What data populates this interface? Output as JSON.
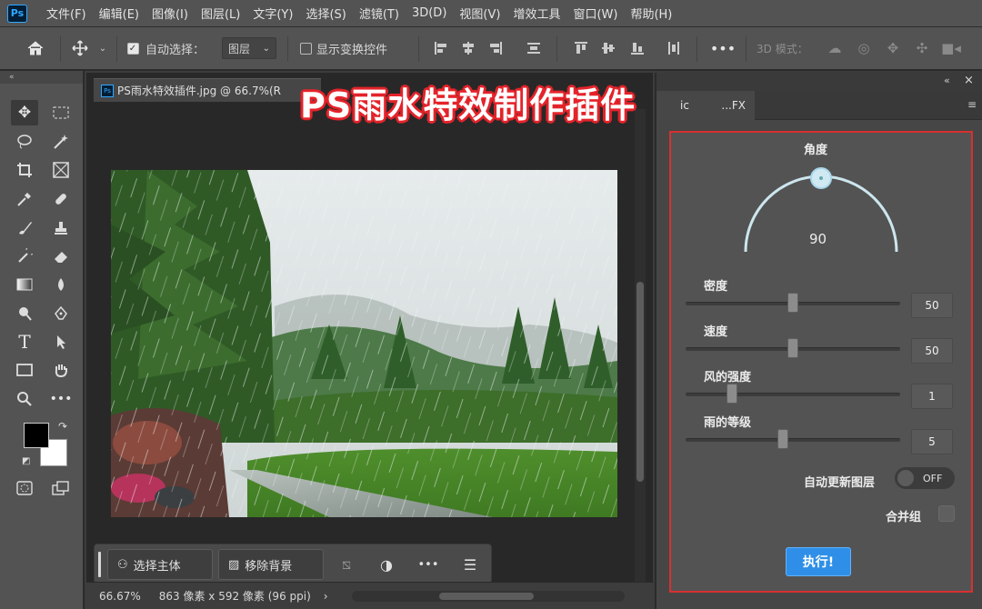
{
  "app": {
    "logo": "Ps"
  },
  "menu": [
    "文件(F)",
    "编辑(E)",
    "图像(I)",
    "图层(L)",
    "文字(Y)",
    "选择(S)",
    "滤镜(T)",
    "3D(D)",
    "视图(V)",
    "增效工具",
    "窗口(W)",
    "帮助(H)"
  ],
  "options": {
    "auto_select_label": "自动选择：",
    "auto_select_checked": true,
    "auto_select_target": "图层",
    "show_transform_label": "显示变换控件",
    "show_transform_checked": false,
    "mode_3d_label": "3D 模式："
  },
  "toolbar": {
    "collapse_glyph": "«"
  },
  "document": {
    "tab_title": "PS雨水特效插件.jpg @ 66.7%(R",
    "zoom": "66.67%",
    "dimensions": "863 像素 x 592 像素 (96 ppi)",
    "status_arrow": "›"
  },
  "context_bar": {
    "select_subject": "选择主体",
    "remove_background": "移除背景"
  },
  "overlay": {
    "headline": "PS雨水特效制作插件"
  },
  "panel": {
    "tab_label": "...FX",
    "tab_prefix": "ic",
    "angle_label": "角度",
    "angle_value": "90",
    "sliders": [
      {
        "label": "密度",
        "value": "50",
        "fraction": 0.5
      },
      {
        "label": "速度",
        "value": "50",
        "fraction": 0.5
      },
      {
        "label": "风的强度",
        "value": "1",
        "fraction": 0.2
      },
      {
        "label": "雨的等级",
        "value": "5",
        "fraction": 0.45
      }
    ],
    "auto_update_label": "自动更新图层",
    "auto_update_state": "OFF",
    "merge_group_label": "合并组",
    "merge_group_checked": false,
    "run_button": "执行!"
  },
  "colors": {
    "accent": "#2f8fe8",
    "highlight_frame": "#d83030",
    "headline_stroke": "#e4232a",
    "foreground": "#000000",
    "background": "#ffffff"
  }
}
